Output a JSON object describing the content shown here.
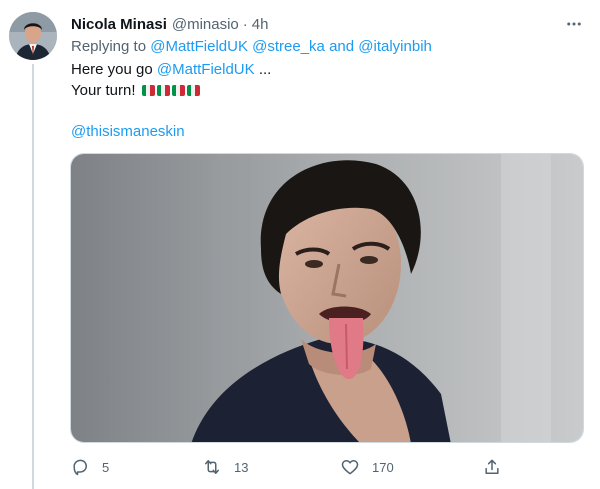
{
  "tweet": {
    "display_name": "Nicola Minasi",
    "handle": "@minasio",
    "separator": "·",
    "time": "4h",
    "replying_prefix": "Replying to",
    "replying_to": [
      "@MattFieldUK",
      "@stree_ka",
      "@italyinbih"
    ],
    "replying_joiner": "and",
    "line1_prefix": "Here you go",
    "line1_mention": "@MattFieldUK",
    "line1_suffix": "...",
    "line2_text": "Your turn!",
    "line3_mention": "@thisismaneskin",
    "flags": [
      "italy-flag",
      "italy-flag",
      "italy-flag",
      "italy-flag"
    ],
    "flag_colors": {
      "green": "#009246",
      "white": "#f1f2f1",
      "red": "#ce2b37"
    }
  },
  "actions": {
    "reply_count": "5",
    "retweet_count": "13",
    "like_count": "170"
  },
  "colors": {
    "accent": "#1d9bf0",
    "secondary_text": "#536471",
    "primary_text": "#0f1419",
    "divider": "#cfd9de"
  },
  "icons": {
    "more": "more-horizontal-icon",
    "reply": "reply-icon",
    "retweet": "retweet-icon",
    "like": "heart-icon",
    "share": "share-icon"
  }
}
